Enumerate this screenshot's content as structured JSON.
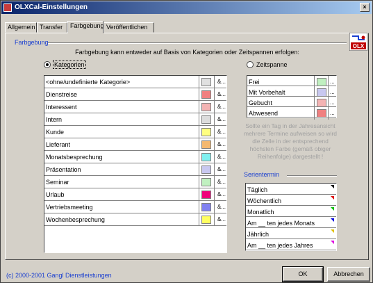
{
  "window": {
    "title": "OLXCal-Einstellungen",
    "close_label": "×"
  },
  "tabs": [
    {
      "label": "Allgemein"
    },
    {
      "label": "Transfer"
    },
    {
      "label": "Farbgebung"
    },
    {
      "label": "Veröffentlichen"
    }
  ],
  "section": {
    "title": "Farbgebung",
    "logo_text": "OLX",
    "description": "Farbgebung kann entweder auf Basis von Kategorien oder Zeitspannen erfolgen:"
  },
  "options": {
    "kategorien": {
      "label": "Kategorien",
      "selected": true
    },
    "zeitspanne": {
      "label": "Zeitspanne",
      "selected": false
    }
  },
  "categories": [
    {
      "name": "<ohne/undefinierte Kategorie>",
      "color": "#e0e0e0",
      "button": "&..."
    },
    {
      "name": "Dienstreise",
      "color": "#f08080",
      "button": "&..."
    },
    {
      "name": "Interessent",
      "color": "#f4b4b4",
      "button": "&..."
    },
    {
      "name": "Intern",
      "color": "#dcdcdc",
      "button": "&..."
    },
    {
      "name": "Kunde",
      "color": "#ffff80",
      "button": "&..."
    },
    {
      "name": "Lieferant",
      "color": "#f4b870",
      "button": "&..."
    },
    {
      "name": "Monatsbesprechung",
      "color": "#80f0f0",
      "button": "&..."
    },
    {
      "name": "Präsentation",
      "color": "#c8c8f0",
      "button": "&..."
    },
    {
      "name": "Seminar",
      "color": "#c0f0c0",
      "button": "&..."
    },
    {
      "name": "Urlaub",
      "color": "#f0007a",
      "button": "&..."
    },
    {
      "name": "Vertriebsmeeting",
      "color": "#8080f0",
      "button": "&..."
    },
    {
      "name": "Wochenbesprechung",
      "color": "#ffff60",
      "button": "&..."
    }
  ],
  "zeitspannen": [
    {
      "name": "Frei",
      "color": "#c0f0c0",
      "button": "..."
    },
    {
      "name": "Mit Vorbehalt",
      "color": "#c8c8f0",
      "button": "..."
    },
    {
      "name": "Gebucht",
      "color": "#f4b4b4",
      "button": "..."
    },
    {
      "name": "Abwesend",
      "color": "#f08080",
      "button": "..."
    }
  ],
  "note": "Sollte ein Tag in der Jahresansicht mehrere Termine aufweisen so wird die Zelle in der entsprechend höchsten Farbe (gemäß obiger Reihenfolge) dargestellt !",
  "serientermin": {
    "title": "Serientermin",
    "items": [
      {
        "name": "Täglich",
        "marker": "#000000"
      },
      {
        "name": "Wöchentlich",
        "marker": "#e00000"
      },
      {
        "name": "Monatlich",
        "marker": "#00c000"
      },
      {
        "name": "Am __ ten jedes Monats",
        "marker": "#0000e0"
      },
      {
        "name": "Jährlich",
        "marker": "#e0c000"
      },
      {
        "name": "Am __ ten jedes Jahres",
        "marker": "#e000e0"
      }
    ]
  },
  "footer": {
    "copyright": "(c) 2000-2001 Gangl Dienstleistungen"
  },
  "buttons": {
    "ok": "OK",
    "cancel": "Abbrechen"
  }
}
